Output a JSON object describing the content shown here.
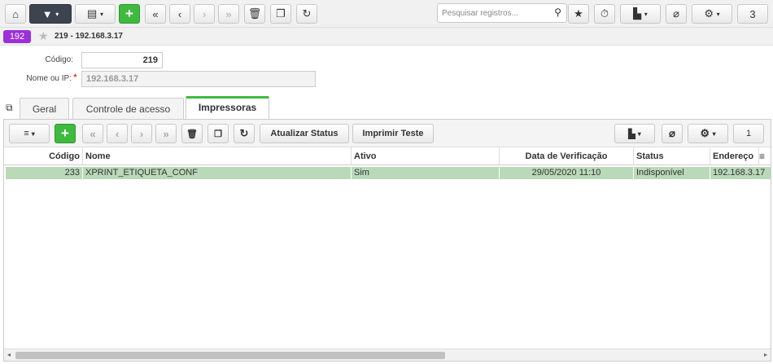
{
  "toolbar": {
    "home_icon": "home-icon",
    "filter_icon": "filter-icon",
    "view_icon": "list-view-icon",
    "add_label": "+",
    "first_label": "«",
    "prev_label": "‹",
    "next_label": "›",
    "last_label": "»",
    "search_placeholder": "Pesquisar registros...",
    "page_count": "3"
  },
  "record": {
    "badge": "192",
    "title": "219 - 192.168.3.17"
  },
  "form": {
    "codigo_label": "Código:",
    "codigo_value": "219",
    "nome_label": "Nome ou IP:",
    "required_mark": "*",
    "nome_value": "192.168.3.17"
  },
  "tabs": [
    "Geral",
    "Controle de acesso",
    "Impressoras"
  ],
  "subtoolbar": {
    "add_label": "+",
    "first_label": "«",
    "prev_label": "‹",
    "next_label": "›",
    "last_label": "»",
    "update_status": "Atualizar Status",
    "print_test": "Imprimir Teste",
    "page_count": "1"
  },
  "grid": {
    "columns": [
      "Código",
      "Nome",
      "Ativo",
      "Data de Verificação",
      "Status",
      "Endereço"
    ],
    "rows": [
      [
        "233",
        "XPRINT_ETIQUETA_CONF",
        "Sim",
        "29/05/2020 11:10",
        "Indisponível",
        "192.168.3.17"
      ]
    ]
  },
  "colors": {
    "accent": "#3fba3f",
    "badge": "#9b30d9",
    "selected_row": "#b9d9b9"
  }
}
